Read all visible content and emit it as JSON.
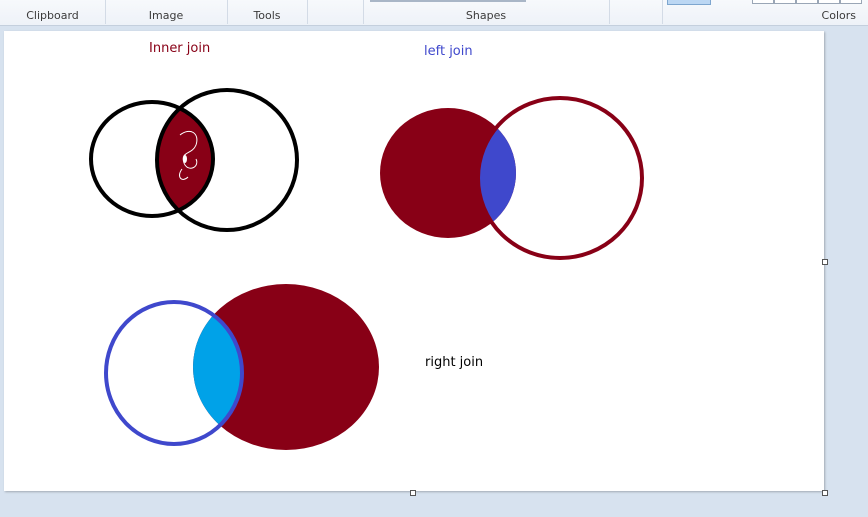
{
  "ribbon": {
    "groups": [
      {
        "id": "clipboard",
        "label": "Clipboard"
      },
      {
        "id": "image",
        "label": "Image"
      },
      {
        "id": "tools",
        "label": "Tools"
      },
      {
        "id": "shapes",
        "label": "Shapes"
      },
      {
        "id": "colors",
        "label": "Colors"
      }
    ]
  },
  "canvas": {
    "labels": {
      "inner_join": "Inner join",
      "left_join": "left join",
      "right_join": "right join"
    }
  },
  "colors": {
    "dark_red": "#880016",
    "blue": "#3f48cc",
    "light_blue": "#00a2e8",
    "black": "#000000",
    "white": "#ffffff"
  }
}
